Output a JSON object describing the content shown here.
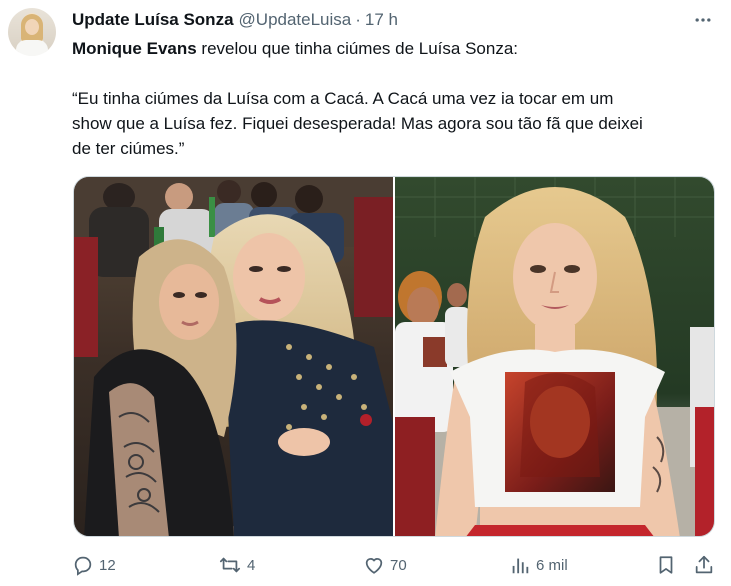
{
  "author": {
    "name": "Update Luísa Sonza",
    "handle": "@UpdateLuisa",
    "separator": "·",
    "time": "17 h"
  },
  "tweet": {
    "mention": "Monique Evans",
    "line1_rest": " revelou que tinha ciúmes de Luísa Sonza:",
    "quote_lines": [
      "“Eu tinha ciúmes da Luísa com a Cacá. A Cacá uma vez ia tocar em um",
      "show que a Luísa fez. Fiquei desesperada! Mas agora sou tão fã que deixei",
      "de ter ciúmes.”"
    ]
  },
  "media": {
    "photos": [
      "photo-two-women-restaurant",
      "photo-blonde-woman-tshirt"
    ]
  },
  "actions": {
    "reply_count": "12",
    "retweet_count": "4",
    "like_count": "70",
    "views_count": "6 mil"
  },
  "icons": [
    "more-icon",
    "reply-icon",
    "retweet-icon",
    "like-icon",
    "views-icon",
    "bookmark-icon",
    "share-icon"
  ],
  "colors": {
    "text": "#0f1419",
    "secondary": "#536471",
    "border": "#cfd9de"
  }
}
